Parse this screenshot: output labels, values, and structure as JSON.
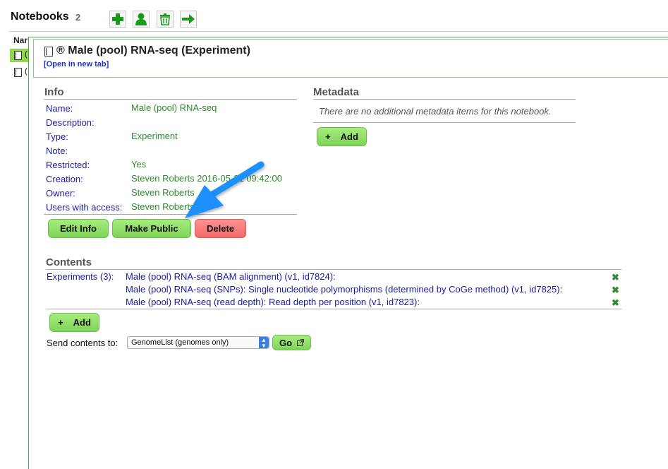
{
  "header": {
    "title": "Notebooks",
    "count": "2"
  },
  "toolbar": {
    "add_icon": "plus-icon",
    "user_icon": "user-icon",
    "delete_icon": "trash-icon",
    "go_icon": "arrow-right-icon"
  },
  "list": {
    "column_header": "Nar",
    "rows": [
      {
        "cut_text": "("
      },
      {
        "cut_text": "("
      }
    ]
  },
  "panel": {
    "title": "® Male (pool) RNA-seq (Experiment)",
    "open_link": "[Open in new tab]"
  },
  "info": {
    "heading": "Info",
    "fields": [
      {
        "label": "Name:",
        "value": "Male (pool) RNA-seq"
      },
      {
        "label": "Description:",
        "value": ""
      },
      {
        "label": "Type:",
        "value": "Experiment"
      },
      {
        "label": "Note:",
        "value": ""
      },
      {
        "label": "Restricted:",
        "value": "Yes"
      },
      {
        "label": "Creation:",
        "value": "Steven Roberts 2016-05-31 09:42:00"
      },
      {
        "label": "Owner:",
        "value": "Steven Roberts"
      },
      {
        "label": "Users with access:",
        "value": "Steven Roberts"
      }
    ],
    "buttons": {
      "edit": "Edit Info",
      "public": "Make Public",
      "delete": "Delete"
    }
  },
  "metadata": {
    "heading": "Metadata",
    "empty_text": "There are no additional metadata items for this notebook.",
    "add_label": "Add"
  },
  "contents": {
    "heading": "Contents",
    "group_label": "Experiments (3):",
    "items": [
      "Male (pool) RNA-seq (BAM alignment) (v1, id7824):",
      "Male (pool) RNA-seq (SNPs): Single nucleotide polymorphisms (determined by CoGe method) (v1, id7825):",
      "Male (pool) RNA-seq (read depth): Read depth per position (v1, id7823):"
    ],
    "add_label": "Add",
    "send_label": "Send contents to:",
    "send_selected": "GenomeList (genomes only)",
    "go_label": "Go"
  },
  "colors": {
    "accent_green": "#7fd458",
    "delete_red": "#f26b6b",
    "link_blue": "#1a1aa6",
    "value_green": "#2e8b2e",
    "annotation_arrow": "#1e90ff"
  }
}
